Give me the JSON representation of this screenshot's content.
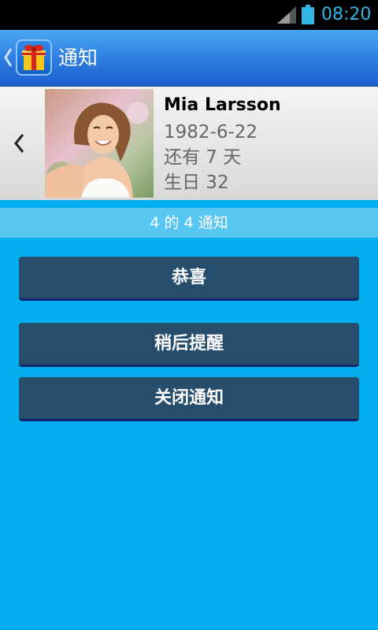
{
  "status_bar": {
    "time": "08:20"
  },
  "header": {
    "title": "通知"
  },
  "contact": {
    "name": "Mia Larsson",
    "birthdate": "1982-6-22",
    "days_left": "还有 7 天",
    "birthday_age": "生日 32"
  },
  "counter": {
    "text": "4 的 4 通知"
  },
  "buttons": {
    "congrats": "恭喜",
    "remind_later": "稍后提醒",
    "close": "关闭通知"
  },
  "colors": {
    "background": "#02aeee",
    "button": "#264e6c",
    "status_time": "#33b5e5"
  }
}
